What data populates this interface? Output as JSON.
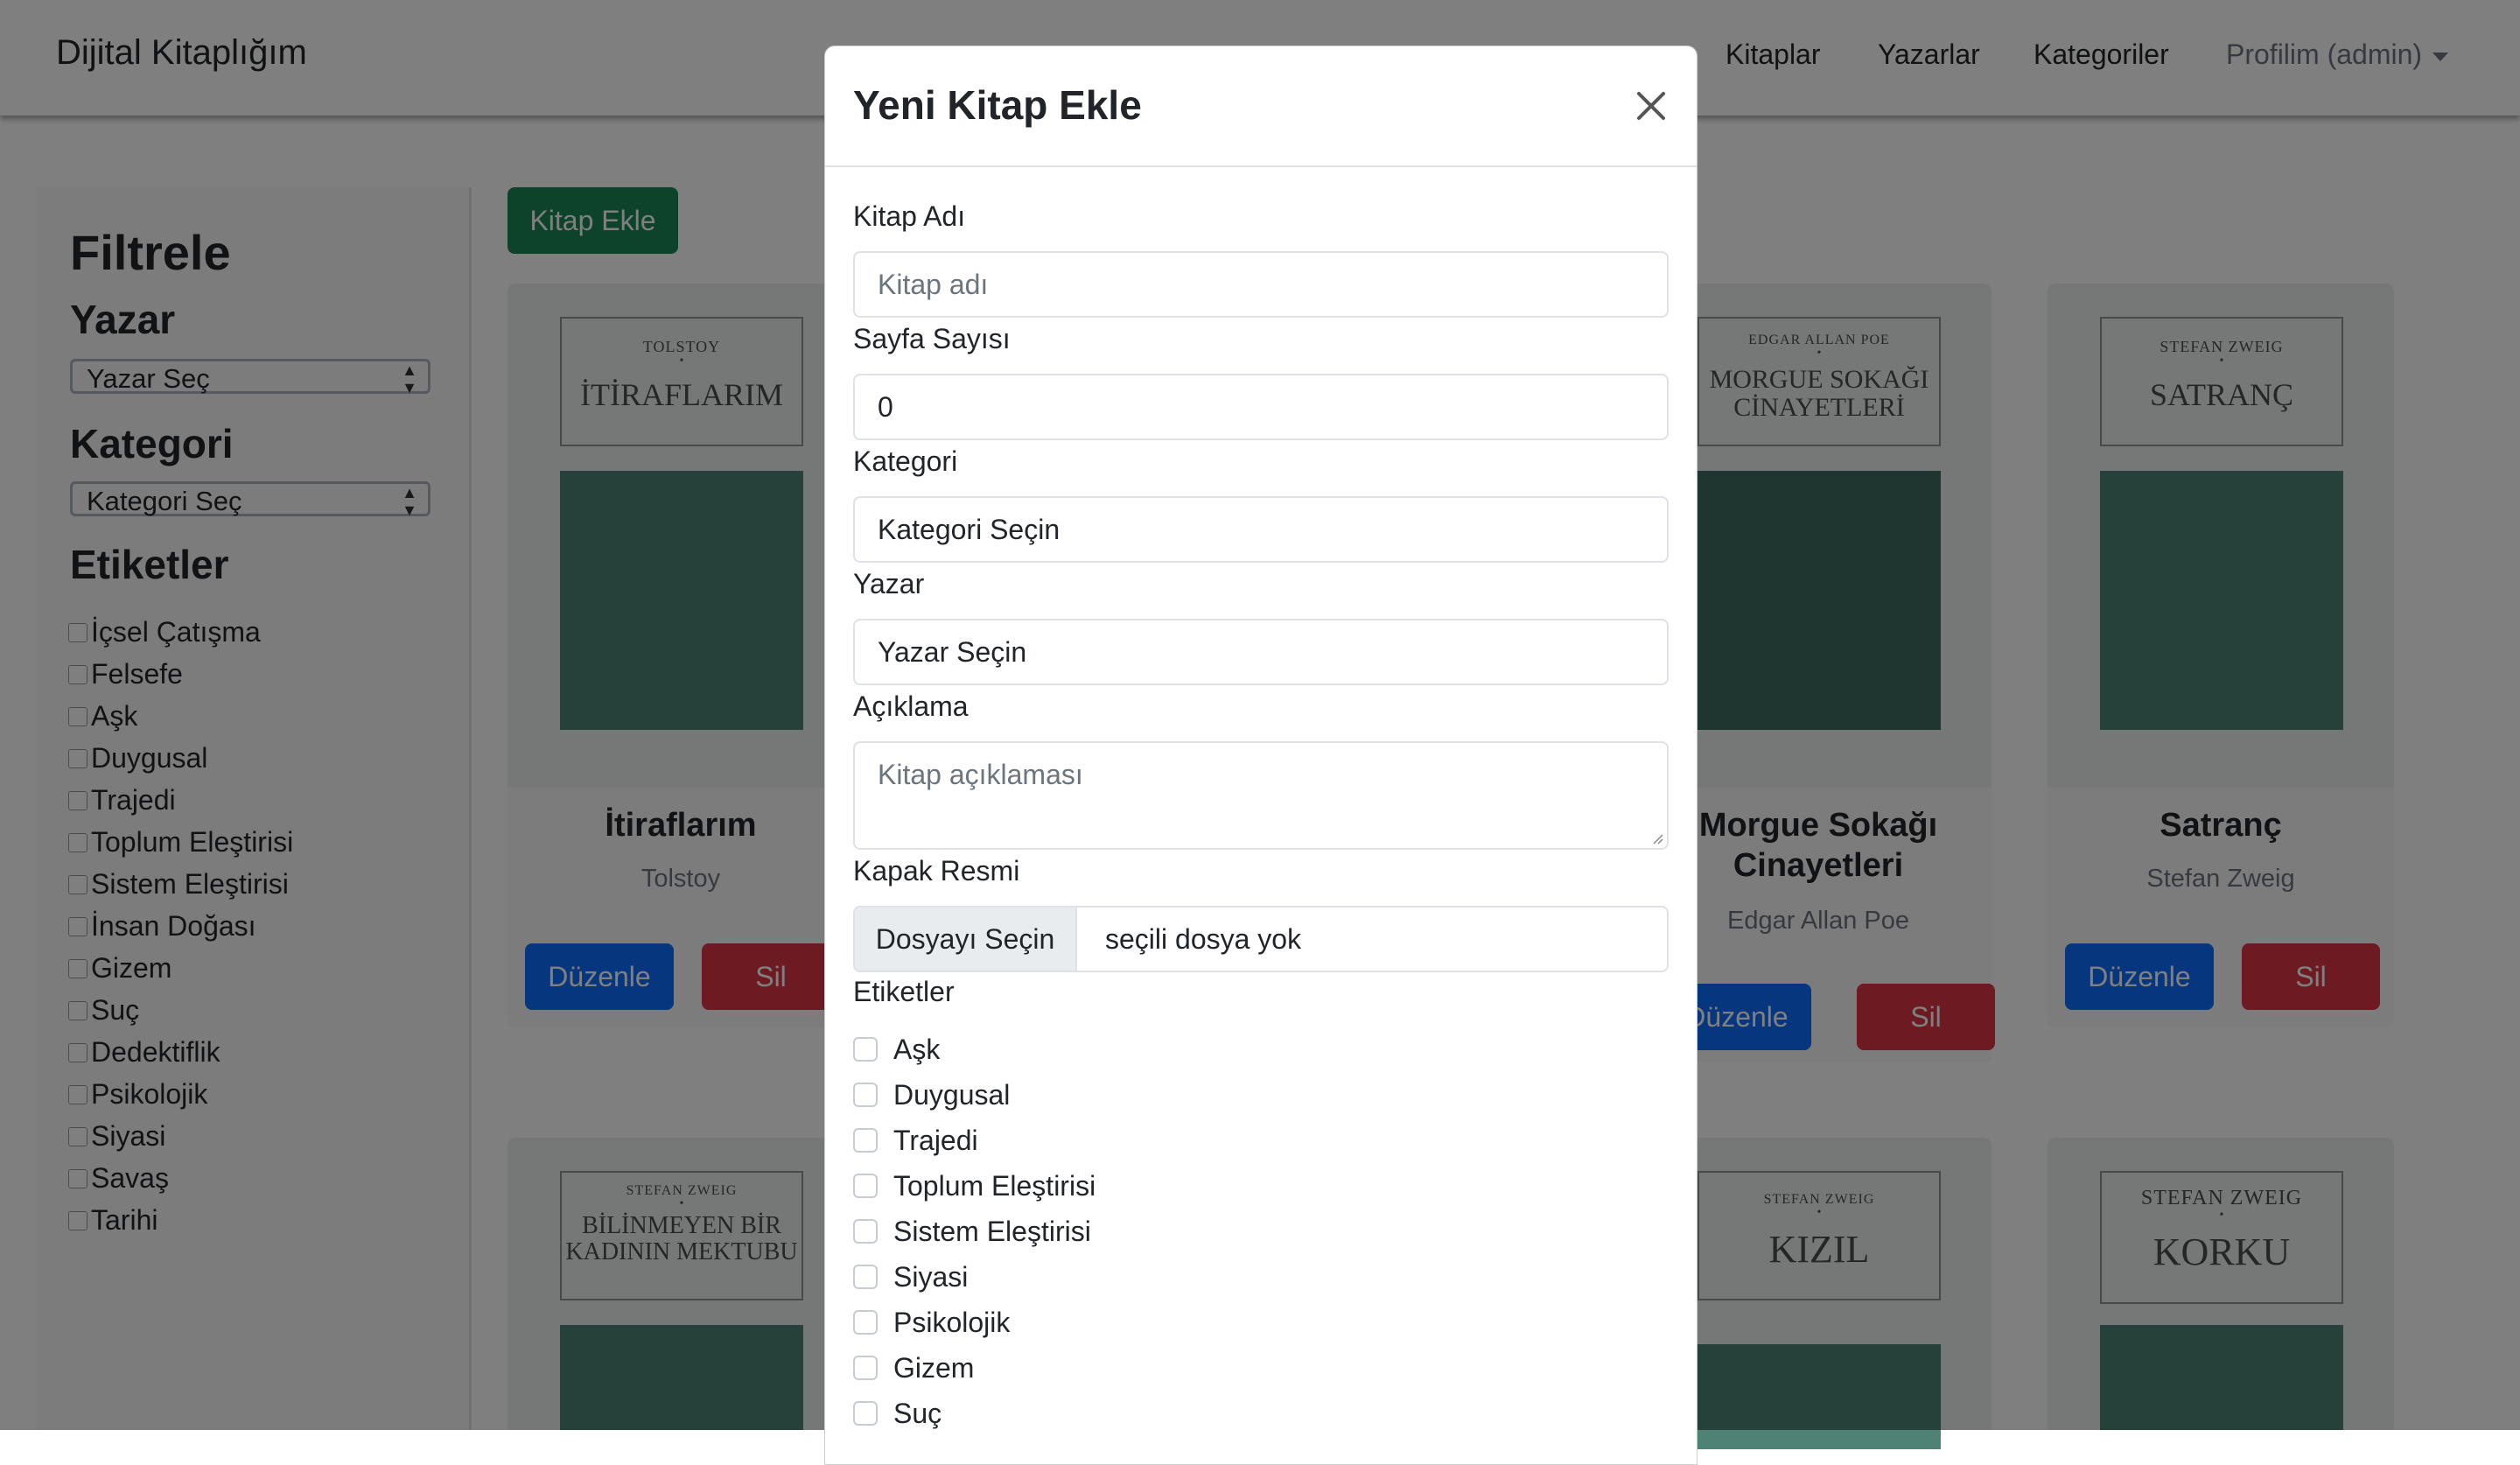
{
  "navbar": {
    "brand": "Dijital Kitaplığım",
    "links": [
      "Kitaplar",
      "Yazarlar",
      "Kategoriler"
    ],
    "profile": "Profilim (admin)"
  },
  "sidebar": {
    "heading": "Filtrele",
    "author_heading": "Yazar",
    "author_select": "Yazar Seç",
    "category_heading": "Kategori",
    "category_select": "Kategori Seç",
    "tags_heading": "Etiketler",
    "tags": [
      "İçsel Çatışma",
      "Felsefe",
      "Aşk",
      "Duygusal",
      "Trajedi",
      "Toplum Eleştirisi",
      "Sistem Eleştirisi",
      "İnsan Doğası",
      "Gizem",
      "Suç",
      "Dedektiflik",
      "Psikolojik",
      "Siyasi",
      "Savaş",
      "Tarihi"
    ]
  },
  "main": {
    "add_button": "Kitap Ekle",
    "edit_label": "Düzenle",
    "delete_label": "Sil",
    "books": [
      {
        "cover_author": "TOLSTOY",
        "cover_title": "İTİRAFLARIM",
        "title": "İtiraflarım",
        "author": "Tolstoy"
      },
      {
        "cover_author": "EDGAR ALLAN POE",
        "cover_title": "MORGUE SOKAĞI CİNAYETLERİ",
        "title": "Morgue Sokağı Cinayetleri",
        "author": "Edgar Allan Poe"
      },
      {
        "cover_author": "STEFAN ZWEIG",
        "cover_title": "SATRANÇ",
        "title": "Satranç",
        "author": "Stefan Zweig"
      },
      {
        "cover_author": "STEFAN ZWEIG",
        "cover_title": "BİLİNMEYEN BİR KADININ MEKTUBU"
      },
      {
        "cover_author": "STEFAN ZWEIG",
        "cover_title": "KIZIL"
      },
      {
        "cover_author": "STEFAN ZWEIG",
        "cover_title": "KORKU"
      }
    ]
  },
  "modal": {
    "title": "Yeni Kitap Ekle",
    "book_name_label": "Kitap Adı",
    "book_name_placeholder": "Kitap adı",
    "page_count_label": "Sayfa Sayısı",
    "page_count_value": "0",
    "category_label": "Kategori",
    "category_value": "Kategori Seçin",
    "author_label": "Yazar",
    "author_value": "Yazar Seçin",
    "description_label": "Açıklama",
    "description_placeholder": "Kitap açıklaması",
    "cover_label": "Kapak Resmi",
    "file_button": "Dosyayı Seçin",
    "file_status": "seçili dosya yok",
    "tags_label": "Etiketler",
    "tags": [
      "Aşk",
      "Duygusal",
      "Trajedi",
      "Toplum Eleştirisi",
      "Sistem Eleştirisi",
      "Siyasi",
      "Psikolojik",
      "Gizem",
      "Suç"
    ]
  },
  "colors": {
    "success": "#198754",
    "primary": "#0d6efd",
    "danger": "#dc3545",
    "cover_art": "#4d8274"
  }
}
